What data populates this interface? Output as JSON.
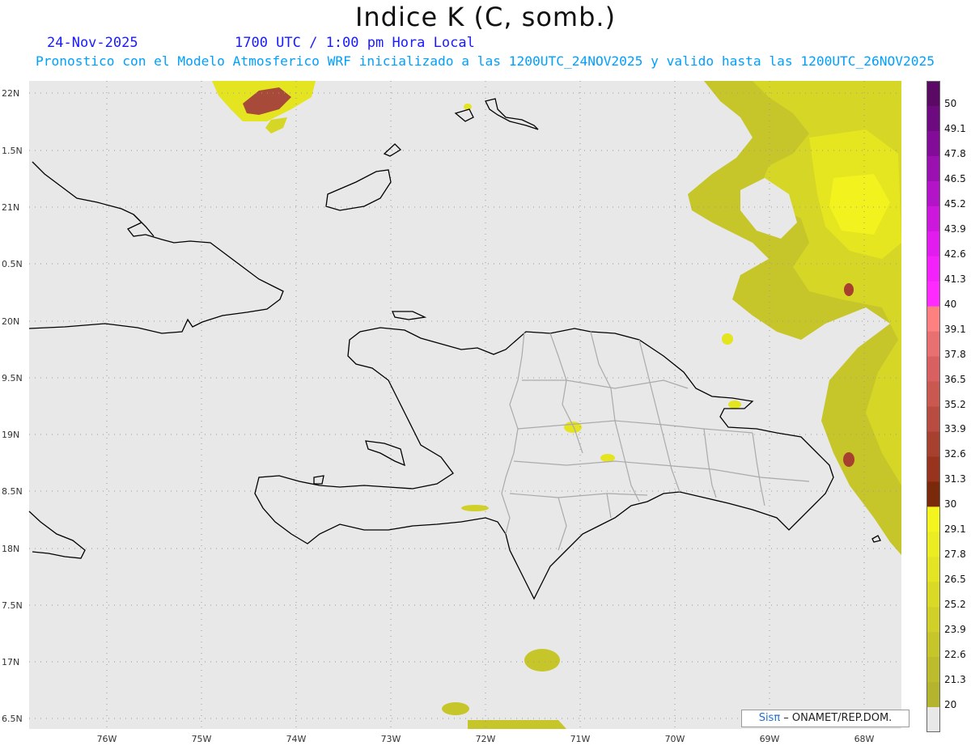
{
  "title": "Indice K (C, somb.)",
  "date": "24-Nov-2025",
  "time_text": "1700 UTC / 1:00 pm Hora Local",
  "subtitle": "Pronostico con el Modelo Atmosferico WRF inicializado a las 1200UTC_24NOV2025 y valido hasta las  1200UTC_26NOV2025",
  "credit": {
    "brand": "Sisπ",
    "rest": " – ONAMET/REP.DOM."
  },
  "axes": {
    "lat_labels": [
      "22N",
      "1.5N",
      "21N",
      "0.5N",
      "20N",
      "9.5N",
      "19N",
      "8.5N",
      "18N",
      "7.5N",
      "17N",
      "6.5N"
    ],
    "lon_labels": [
      "76W",
      "75W",
      "74W",
      "73W",
      "72W",
      "71W",
      "70W",
      "69W",
      "68W"
    ]
  },
  "colorbar": {
    "labels": [
      "50",
      "49.1",
      "47.8",
      "46.5",
      "45.2",
      "43.9",
      "42.6",
      "41.3",
      "40",
      "39.1",
      "37.8",
      "36.5",
      "35.2",
      "33.9",
      "32.6",
      "31.3",
      "30",
      "29.1",
      "27.8",
      "26.5",
      "25.2",
      "23.9",
      "22.6",
      "21.3",
      "20"
    ],
    "colors": [
      "#5a0a64",
      "#6e0a80",
      "#820c98",
      "#9a10b0",
      "#b414c8",
      "#cc18dc",
      "#e21cee",
      "#f422fa",
      "#ff2aff",
      "#ff8080",
      "#e87070",
      "#d86060",
      "#c85850",
      "#b84c40",
      "#a84030",
      "#98341e",
      "#7a2a0a",
      "#f4f41e",
      "#ecec22",
      "#e4e424",
      "#dada26",
      "#d0d028",
      "#c6c62a",
      "#bcbc2c",
      "#b4b42e"
    ]
  },
  "colors": {
    "ocean": "#e8e8e8",
    "field": "#d6d62a",
    "coast": "#000000",
    "borders": "#aaaaaa"
  }
}
